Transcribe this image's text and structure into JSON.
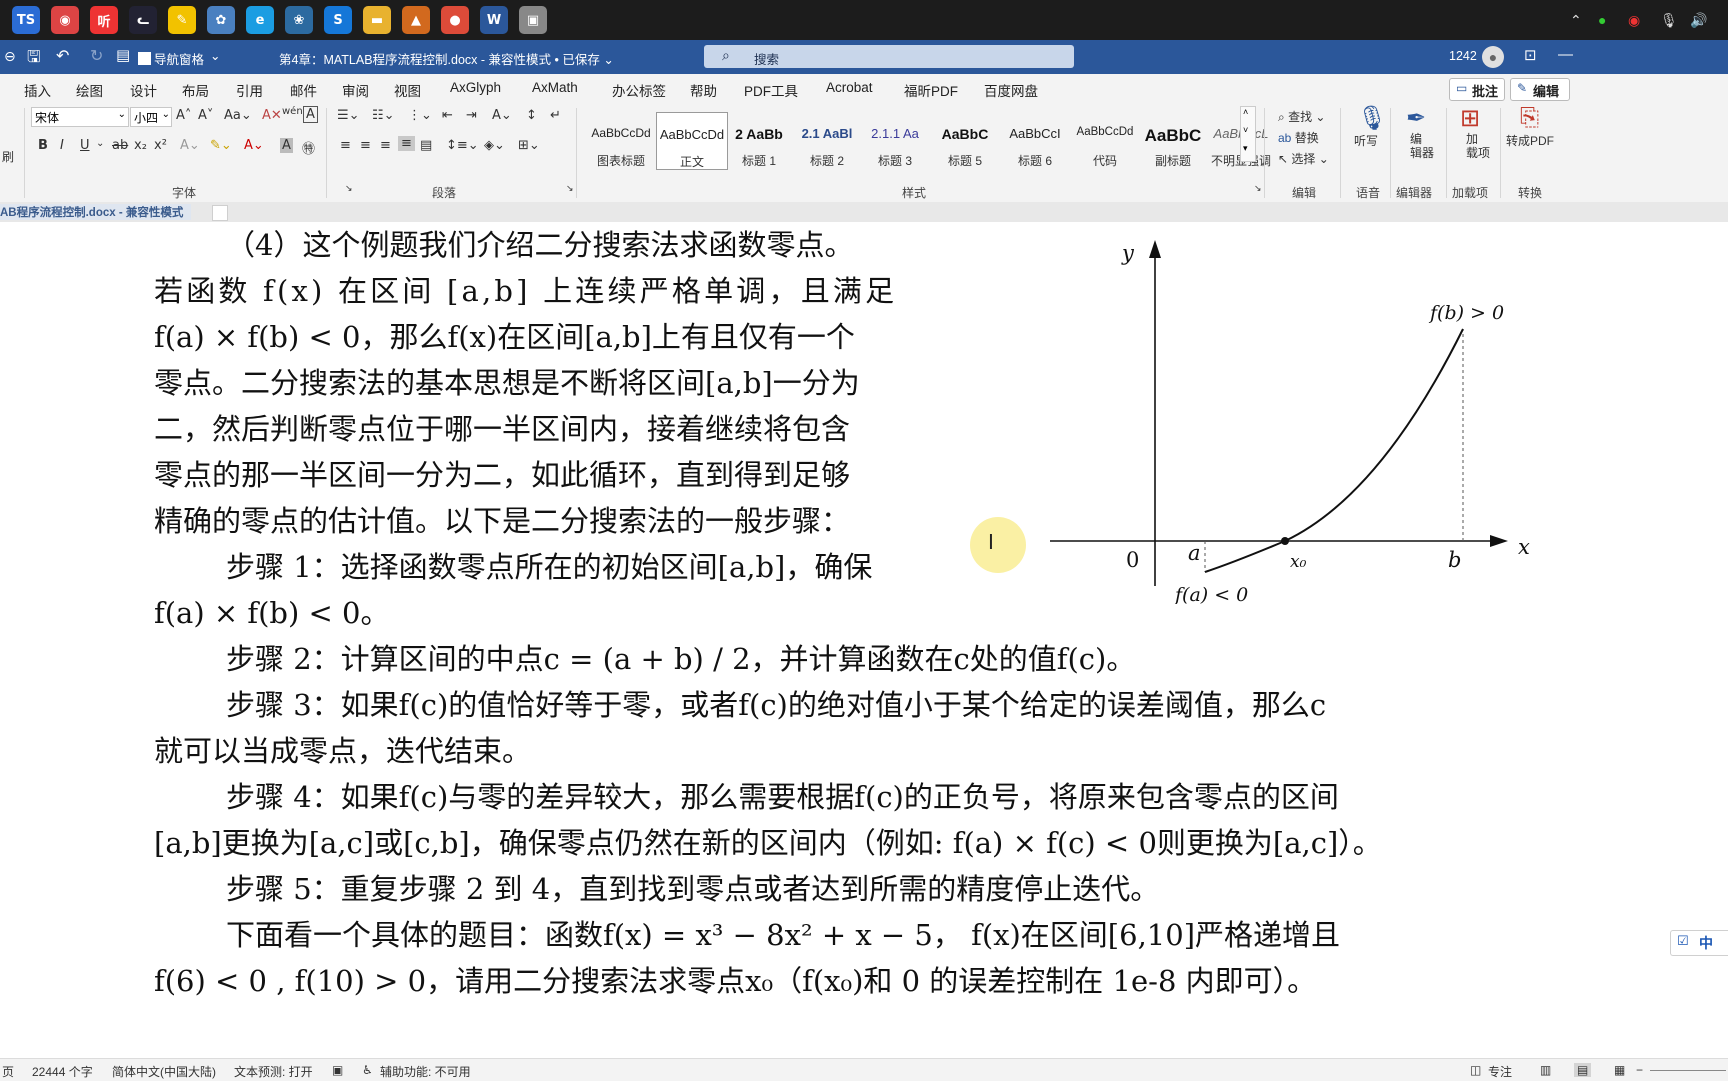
{
  "taskbar": {
    "apps": [
      {
        "name": "ts-app-icon",
        "glyph": "TS",
        "color": "#2b6cd4"
      },
      {
        "name": "browser-360-icon",
        "glyph": "◉",
        "color": "#d44"
      },
      {
        "name": "media-app-icon",
        "glyph": "听",
        "color": "#e33"
      },
      {
        "name": "cat-app-icon",
        "glyph": "ᓚ",
        "color": "#223"
      },
      {
        "name": "sticky-notes-icon",
        "glyph": "✎",
        "color": "#f2c200"
      },
      {
        "name": "paint-icon",
        "glyph": "✿",
        "color": "#4a80c0"
      },
      {
        "name": "edge-browser-icon",
        "glyph": "e",
        "color": "#1b9de2"
      },
      {
        "name": "mushroom-app-icon",
        "glyph": "❀",
        "color": "#2c6aa0"
      },
      {
        "name": "sogou-icon",
        "glyph": "S",
        "color": "#1577d8"
      },
      {
        "name": "folder-icon",
        "glyph": "▬",
        "color": "#e8b22f"
      },
      {
        "name": "matlab-icon",
        "glyph": "▲",
        "color": "#d2691e"
      },
      {
        "name": "chrome-icon",
        "glyph": "●",
        "color": "#dd4b39"
      },
      {
        "name": "word-icon",
        "glyph": "W",
        "color": "#2b579a"
      },
      {
        "name": "screen-capture-icon",
        "glyph": "▣",
        "color": "#888"
      }
    ]
  },
  "titlebar": {
    "nav_pane_label": "导航窗格",
    "doc_title": "第4章：MATLAB程序流程控制.docx  -  兼容性模式  •  已保存 ⌄",
    "search_placeholder": "搜索",
    "user_id": "1242"
  },
  "menu": {
    "items": [
      "插入",
      "绘图",
      "设计",
      "布局",
      "引用",
      "邮件",
      "审阅",
      "视图",
      "AxGlyph",
      "AxMath",
      "办公标签",
      "帮助",
      "PDF工具",
      "Acrobat",
      "福昕PDF",
      "百度网盘"
    ],
    "comment_button": "批注",
    "edit_button": "编辑"
  },
  "ribbon": {
    "font_name": "宋体",
    "font_size": "小四",
    "group_font": "字体",
    "group_paragraph": "段落",
    "group_styles": "样式",
    "group_edit": "编辑",
    "group_voice": "语音",
    "group_editor": "编辑器",
    "group_addins": "加载项",
    "group_convert": "转换",
    "styles": [
      {
        "sample": "AaBbCcDd",
        "name": "图表标题"
      },
      {
        "sample": "AaBbCcDd",
        "name": "正文"
      },
      {
        "sample": "2  AaBb",
        "name": "标题 1"
      },
      {
        "sample": "2.1  AaBl",
        "name": "标题 2"
      },
      {
        "sample": "2.1.1  Aa",
        "name": "标题 3"
      },
      {
        "sample": "AaBbC",
        "name": "标题 5"
      },
      {
        "sample": "AaBbCcI",
        "name": "标题 6"
      },
      {
        "sample": "AaBbCcDd",
        "name": "代码"
      },
      {
        "sample": "AaBbC",
        "name": "副标题"
      },
      {
        "sample": "AaBbCcL",
        "name": "不明显强调"
      }
    ],
    "find": "查找",
    "replace": "替换",
    "select": "选择",
    "dictate": "听写",
    "editor": "编\n辑器",
    "addins": "加\n载项",
    "to_pdf": "转成PDF",
    "clipboard_tail": "刷"
  },
  "docbar": {
    "tab_label": "AB程序流程控制.docx  -  兼容性模式"
  },
  "document": {
    "lines": [
      "（4）这个例题我们介绍二分搜索法求函数零点。",
      "若函数 f(x) 在区间 [a,b] 上连续严格单调，且满足",
      "f(a) × f(b) < 0，那么f(x)在区间[a,b]上有且仅有一个",
      "零点。二分搜索法的基本思想是不断将区间[a,b]一分为",
      "二，然后判断零点位于哪一半区间内，接着继续将包含",
      "零点的那一半区间一分为二，如此循环，直到得到足够",
      "精确的零点的估计值。以下是二分搜索法的一般步骤：",
      "步骤 1：选择函数零点所在的初始区间[a,b]，确保",
      "f(a) × f(b) < 0。",
      "步骤 2：计算区间的中点c = (a + b) / 2，并计算函数在c处的值f(c)。",
      "步骤 3：如果f(c)的值恰好等于零，或者f(c)的绝对值小于某个给定的误差阈值，那么c",
      "就可以当成零点，迭代结束。",
      "步骤 4：如果f(c)与零的差异较大，那么需要根据f(c)的正负号，将原来包含零点的区间",
      "[a,b]更换为[a,c]或[c,b]，确保零点仍然在新的区间内（例如: f(a) × f(c) < 0则更换为[a,c]）。",
      "步骤 5：重复步骤 2 到 4，直到找到零点或者达到所需的精度停止迭代。",
      "下面看一个具体的题目：函数f(x) = x³ − 8x² + x − 5， f(x)在区间[6,10]严格递增且",
      "f(6) < 0 , f(10) > 0，请用二分搜索法求零点x₀（f(x₀)和 0 的误差控制在 1e-8 内即可）。"
    ]
  },
  "figure": {
    "y_label": "y",
    "x_label": "x",
    "origin_label": "0",
    "a_label": "a",
    "x0_label": "x₀",
    "b_label": "b",
    "fb_label": "f(b) > 0",
    "fa_label": "f(a) < 0"
  },
  "side_badge": "中",
  "statusbar": {
    "page": "页",
    "word_count": "22444 个字",
    "language": "简体中文(中国大陆)",
    "text_predict": "文本预测: 打开",
    "accessibility": "辅助功能: 不可用",
    "focus": "专注"
  }
}
